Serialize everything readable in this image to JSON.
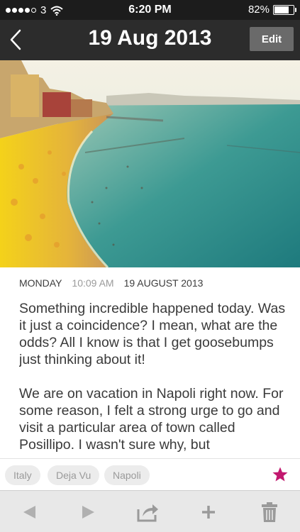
{
  "status_bar": {
    "carrier": "3",
    "time": "6:20 PM",
    "battery_percent_label": "82%",
    "battery_level": 0.82
  },
  "nav": {
    "title": "19 Aug 2013",
    "edit_label": "Edit"
  },
  "entry": {
    "day": "MONDAY",
    "time": "10:09 AM",
    "date": "19 AUGUST 2013",
    "paragraphs": [
      "Something incredible happened today. Was it just a coincidence? I mean, what are the odds? All I know is that I get goosebumps just thinking about it!",
      "We are on vacation in Napoli right now. For some reason, I felt a strong urge to go and visit a particular area of town called Posillipo. I wasn't sure why, but"
    ]
  },
  "tags": [
    "Italy",
    "Deja Vu",
    "Napoli"
  ],
  "colors": {
    "star": "#c2186f",
    "nav_bg": "#2c2c2c",
    "toolbar_icon": "#9a9a9a"
  },
  "icons": {
    "back": "chevron-left-icon",
    "star": "star-icon",
    "previous": "triangle-left-icon",
    "next": "triangle-right-icon",
    "share": "share-icon",
    "add": "plus-icon",
    "delete": "trash-icon"
  }
}
